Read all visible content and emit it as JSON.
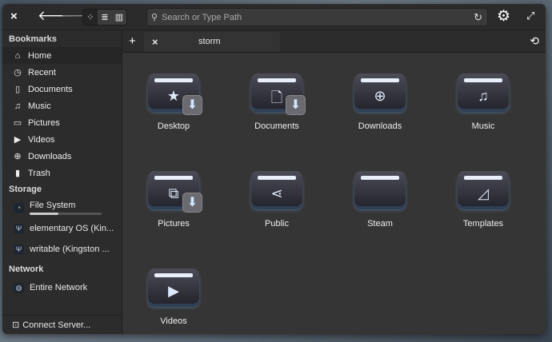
{
  "header": {
    "close": "×",
    "back": "🡐",
    "forward": "🡒",
    "search_placeholder": "Search or Type Path",
    "reload": "↻",
    "settings": "⚙",
    "maximize": "⤢"
  },
  "view_modes": [
    "icon-view",
    "list-view",
    "column-view"
  ],
  "sidebar": {
    "bookmarks_title": "Bookmarks",
    "bookmarks": [
      {
        "label": "Home",
        "icon": "⌂"
      },
      {
        "label": "Recent",
        "icon": "◷"
      },
      {
        "label": "Documents",
        "icon": "▯"
      },
      {
        "label": "Music",
        "icon": "♫"
      },
      {
        "label": "Pictures",
        "icon": "▭"
      },
      {
        "label": "Videos",
        "icon": "▶"
      },
      {
        "label": "Downloads",
        "icon": "⊕"
      },
      {
        "label": "Trash",
        "icon": "▮"
      }
    ],
    "storage_title": "Storage",
    "storage": [
      {
        "label": "File System",
        "usage": 0.4
      },
      {
        "label": "elementary OS (Kin..."
      },
      {
        "label": "writable (Kingston ..."
      }
    ],
    "network_title": "Network",
    "network": [
      {
        "label": "Entire Network"
      }
    ],
    "connect_server": "Connect Server..."
  },
  "tabs": {
    "add": "+",
    "close": "×",
    "active": "storm",
    "history": "⟲"
  },
  "folders": [
    {
      "name": "Desktop",
      "glyph": "★",
      "emblem": "⬇"
    },
    {
      "name": "Documents",
      "glyph": "🗋",
      "emblem": "⬇"
    },
    {
      "name": "Downloads",
      "glyph": "⊕"
    },
    {
      "name": "Music",
      "glyph": "♫"
    },
    {
      "name": "Pictures",
      "glyph": "⧉",
      "emblem": "⬇"
    },
    {
      "name": "Public",
      "glyph": "⋖"
    },
    {
      "name": "Steam",
      "glyph": ""
    },
    {
      "name": "Templates",
      "glyph": "◿"
    },
    {
      "name": "Videos",
      "glyph": "▶"
    }
  ]
}
